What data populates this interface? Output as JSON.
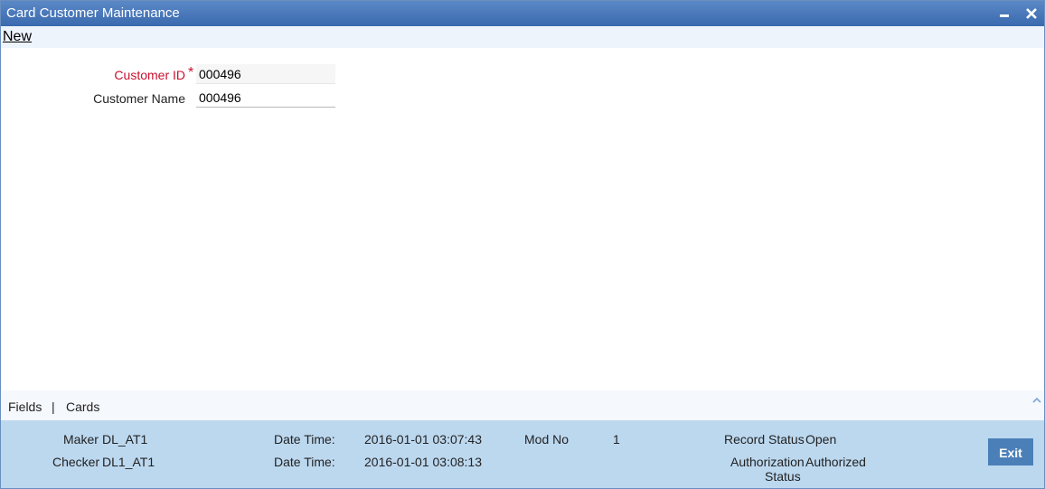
{
  "window": {
    "title": "Card Customer Maintenance"
  },
  "toolbar": {
    "new_label": "New"
  },
  "form": {
    "customer_id": {
      "label": "Customer ID",
      "required_mark": "*",
      "value": "000496"
    },
    "customer_name": {
      "label": "Customer Name",
      "value": "000496"
    }
  },
  "tabs": {
    "fields": "Fields",
    "separator": "|",
    "cards": "Cards"
  },
  "audit": {
    "maker_label": "Maker",
    "maker_value": "DL_AT1",
    "checker_label": "Checker",
    "checker_value": "DL1_AT1",
    "maker_datetime_label": "Date Time:",
    "maker_datetime_value": "2016-01-01 03:07:43",
    "checker_datetime_label": "Date Time:",
    "checker_datetime_value": "2016-01-01 03:08:13",
    "mod_no_label": "Mod No",
    "mod_no_value": "1",
    "record_status_label": "Record Status",
    "record_status_value": "Open",
    "auth_status_label_1": "Authorization",
    "auth_status_label_2": "Status",
    "auth_status_value": "Authorized",
    "exit_label": "Exit"
  },
  "colors": {
    "titlebar": "#3a6aae",
    "audit_bg": "#bcd8ef",
    "required": "#c8102e",
    "exit_button": "#4b7fb8"
  },
  "icons": {
    "minimize": "minimize-icon",
    "close": "close-icon",
    "collapse": "chevron-up-icon"
  }
}
